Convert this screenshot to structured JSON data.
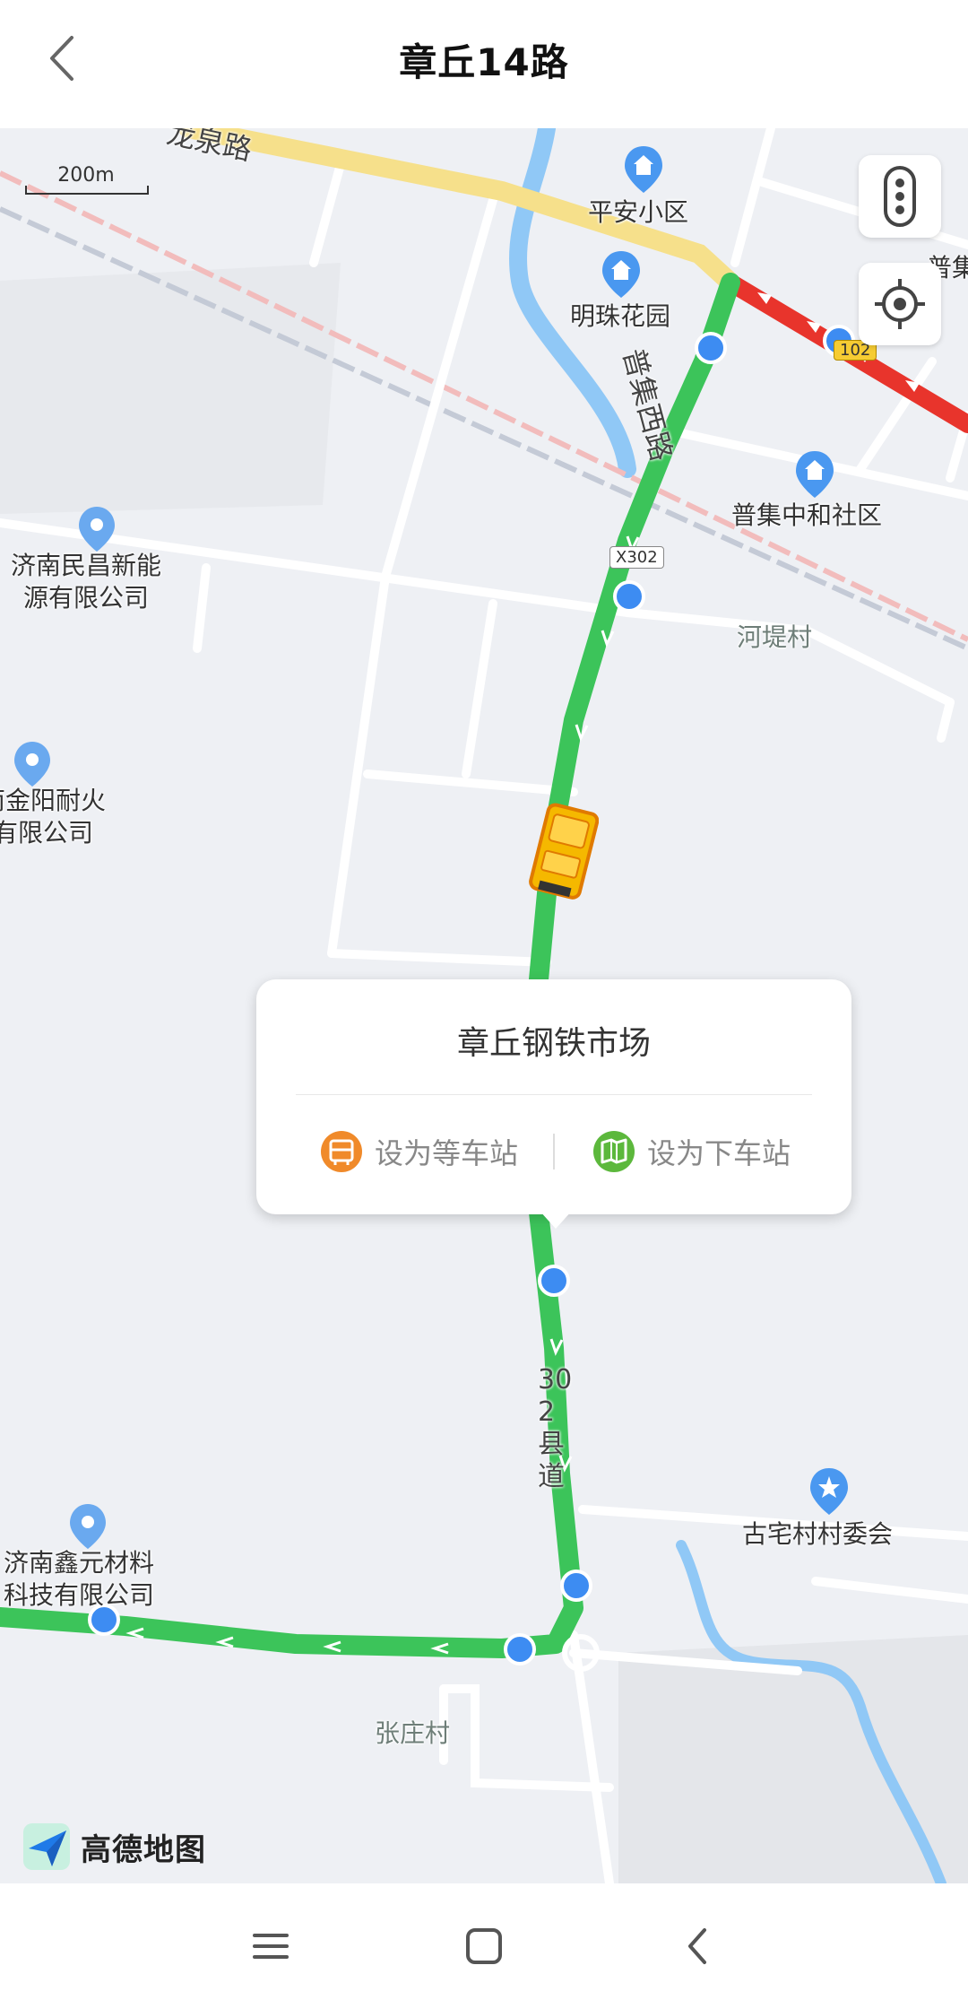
{
  "header": {
    "title": "章丘14路",
    "back_icon": "chevron-left-icon"
  },
  "map": {
    "scale_label": "200m",
    "road_labels": {
      "longquan": "龙泉路",
      "puji_west": "普集西路",
      "x302": "X302",
      "county": "302县道",
      "g102": "102"
    },
    "pois": {
      "pingan": "平安小区",
      "mingzhu": "明珠花园",
      "puji_zhonghe": "普集中和社区",
      "jinan_minchang": "济南民昌新能\n源有限公司",
      "jinyang": "南金阳耐火\n有限公司",
      "gucun": "古宅村村委会",
      "xinyuan": "济南鑫元材料\n科技有限公司",
      "puji_edge": "普集"
    },
    "villages": {
      "hedi": "河堤村",
      "zhangzhuang": "张庄村"
    },
    "colors": {
      "route": "#3cc45a",
      "congested": "#e8342c",
      "station": "#3d8cf2",
      "bus": "#f5b800",
      "main_road": "#f6e08b",
      "water": "#90c8f6"
    }
  },
  "popup": {
    "station_name": "章丘钢铁市场",
    "set_wait_label": "设为等车站",
    "set_alight_label": "设为下车站"
  },
  "logo": {
    "text": "高德地图"
  },
  "navbar": {
    "menu_icon": "menu-icon",
    "home_icon": "home-icon",
    "back_icon": "back-icon"
  }
}
